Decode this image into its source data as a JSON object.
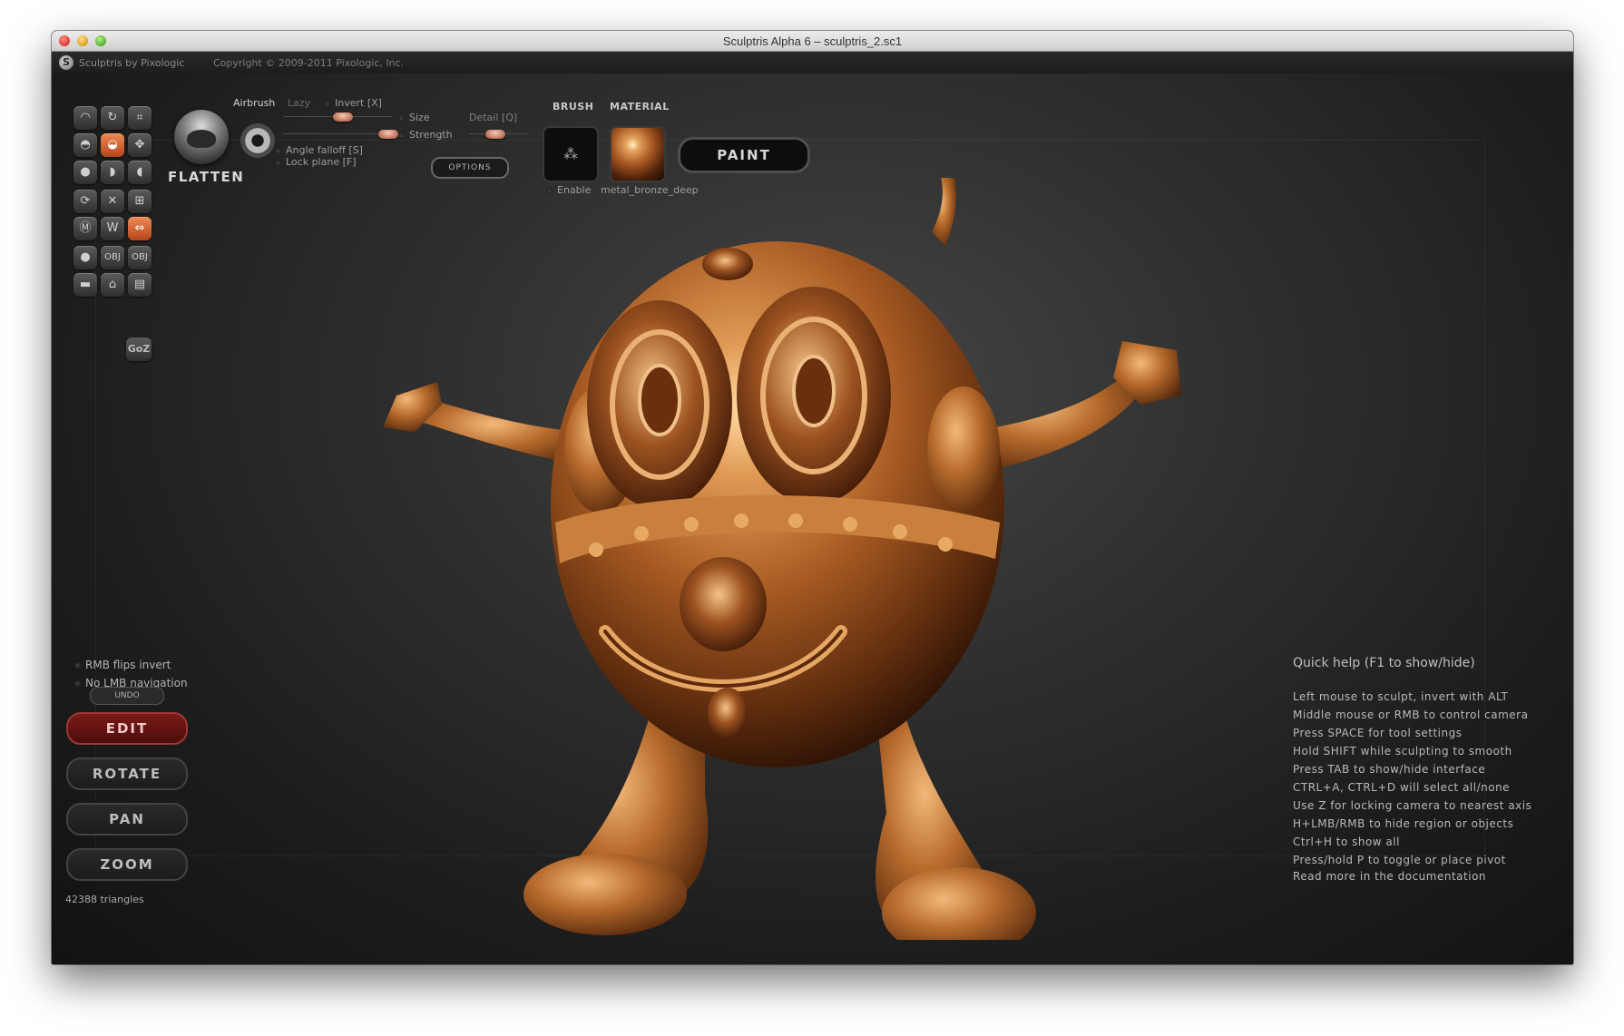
{
  "window": {
    "title": "Sculptris Alpha 6 – sculptris_2.sc1"
  },
  "appbar": {
    "app_name": "Sculptris by Pixologic",
    "copyright": "Copyright © 2009-2011 Pixologic, Inc."
  },
  "toolbar": {
    "tool_name": "FLATTEN",
    "airbrush": "Airbrush",
    "lazy": "Lazy",
    "invert": "Invert [X]",
    "size": "Size",
    "strength": "Strength",
    "detail": "Detail [Q]",
    "angle_falloff": "Angle falloff [S]",
    "lock_plane": "Lock plane [F]",
    "options": "OPTIONS",
    "brush_heading": "BRUSH",
    "material_heading": "MATERIAL",
    "enable": "Enable",
    "material_name": "metal_bronze_deep",
    "paint": "PAINT",
    "size_value": 0.5,
    "strength_value": 0.9,
    "detail_value": 0.55
  },
  "tools": {
    "group1": [
      "sculpt-icon",
      "rotate-icon",
      "crop-icon",
      "inflate-icon",
      "flatten-icon",
      "move-icon",
      "grab-icon",
      "crease-icon",
      "pinch-icon"
    ],
    "group2": [
      "smooth-icon",
      "reduce-icon",
      "subdivide-icon",
      "mask-icon",
      "wireframe-icon",
      "symmetry-icon"
    ],
    "group3": [
      "sphere-icon",
      "obj-import-icon",
      "obj-export-icon",
      "plane-icon",
      "open-file-icon",
      "save-file-icon"
    ],
    "goz": "GoZ"
  },
  "sidebar": {
    "rmb_flips_invert": "RMB flips invert",
    "no_lmb_navigation": "No LMB navigation",
    "undo": "UNDO",
    "edit": "EDIT",
    "rotate": "ROTATE",
    "pan": "PAN",
    "zoom": "ZOOM",
    "triangles": "42388 triangles"
  },
  "help": {
    "title": "Quick help (F1 to show/hide)",
    "lines": [
      "Left mouse to sculpt, invert with ALT",
      "Middle mouse or RMB to control camera",
      "Press SPACE for tool settings",
      "Hold SHIFT while sculpting to smooth",
      "Press TAB to show/hide interface",
      "CTRL+A, CTRL+D will select all/none",
      "Use Z for locking camera to nearest axis",
      "H+LMB/RMB to hide region or objects",
      "Ctrl+H to show all",
      "Press/hold P to toggle or place pivot"
    ],
    "more": "Read more in the documentation"
  },
  "colors": {
    "accent": "#d0692f",
    "edit_active": "#6a1514",
    "bronze": "#b8692a"
  }
}
